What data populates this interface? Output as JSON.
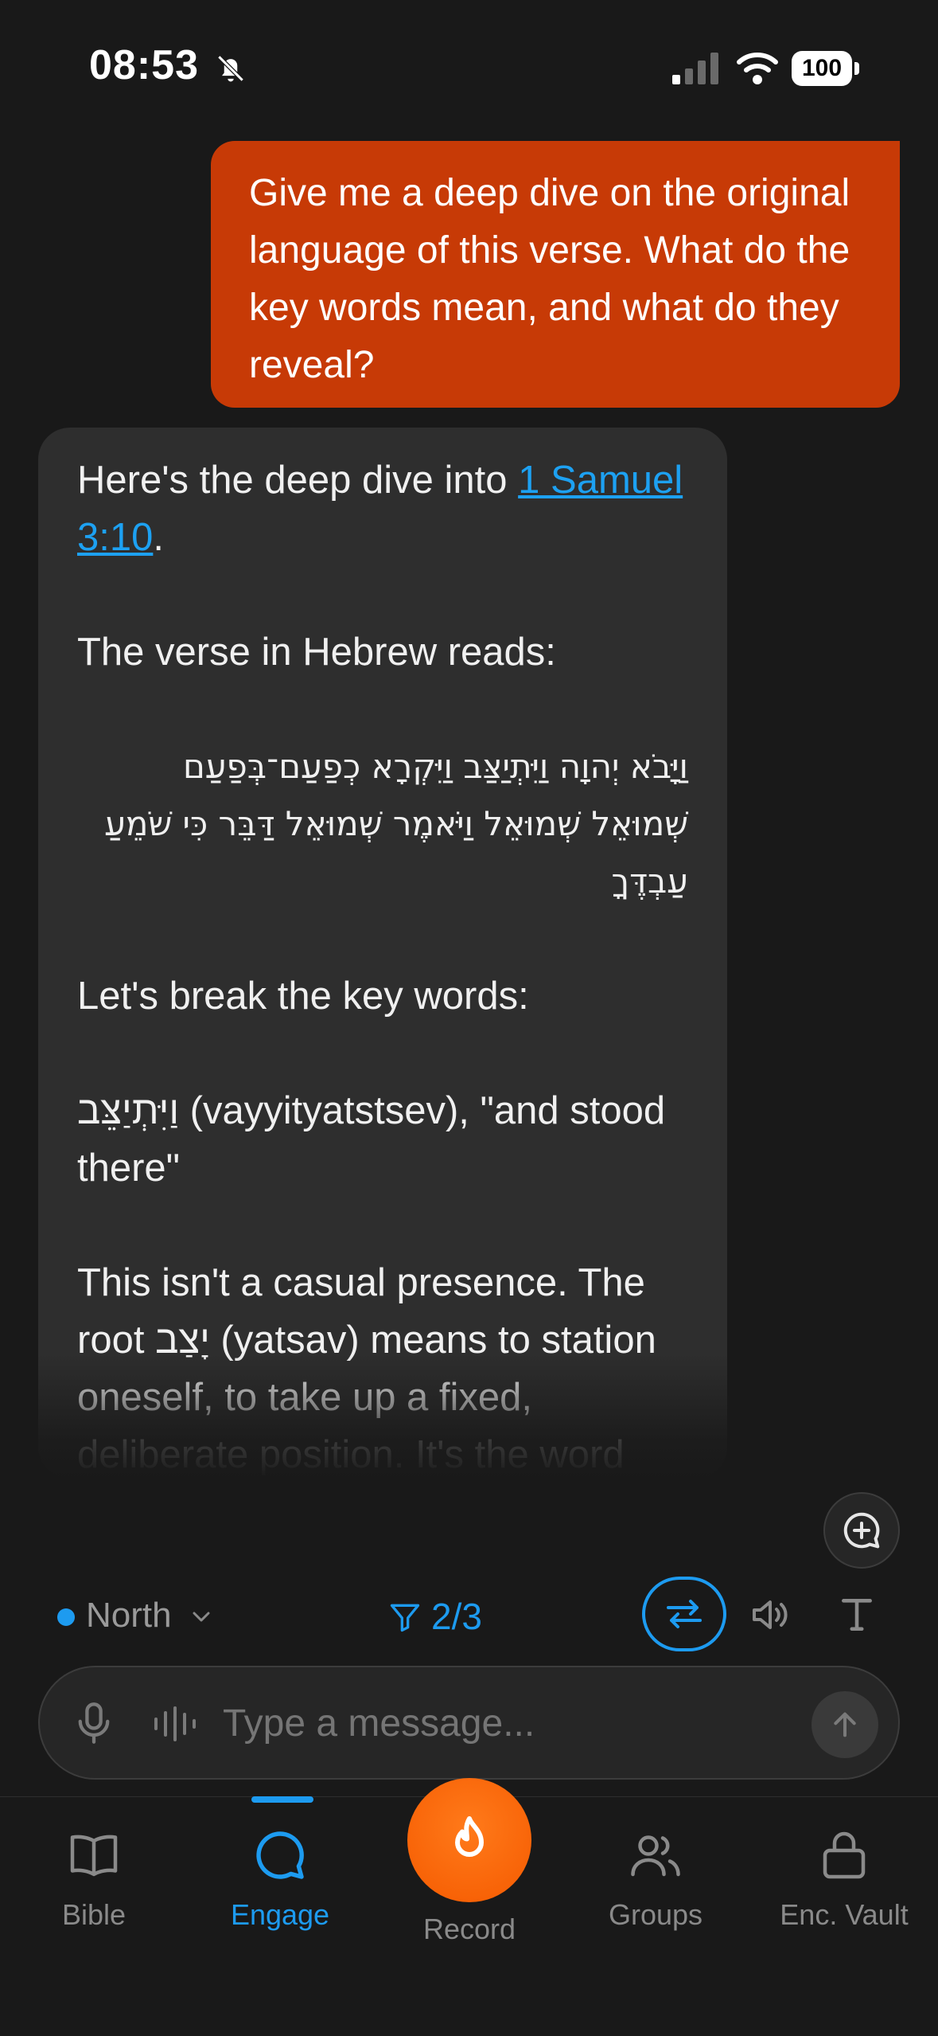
{
  "status_bar": {
    "time": "08:53",
    "battery": "100"
  },
  "conversation": {
    "user_message": "Give me a deep dive on the original language of this verse. What do the key words mean, and what do they reveal?",
    "assistant": {
      "intro_prefix": "Here's the deep dive into ",
      "intro_link": "1 Samuel 3:10",
      "intro_suffix": ".",
      "hebrew_intro": "The verse in Hebrew reads:",
      "hebrew_text": "וַיָּבֹא יְהוָה וַיִּתְיַצַּב וַיִּקְרָא כְפַעַם־בְּפַעַם שְׁמוּאֵל שְׁמוּאֵל וַיֹּאמֶר שְׁמוּאֵל דַּבֵּר כִּי שֹׁמֵעַ עַבְדֶּךָ",
      "breakdown_intro": "Let's break the key words:",
      "word_entry": "וַיִּתְיַצֵּב (vayyityatstsev), \"and stood there\"",
      "paragraph": "This isn't a casual presence. The root יָצַב (yatsav) means to station oneself, to take up a fixed, deliberate position. It's the word"
    }
  },
  "controls": {
    "direction_label": "North",
    "filter_label": "2/3",
    "accent_color": "#1d9bf0"
  },
  "input": {
    "placeholder": "Type a message..."
  },
  "tabs": [
    {
      "label": "Bible",
      "icon": "book-icon"
    },
    {
      "label": "Engage",
      "icon": "chat-bubble-icon",
      "active": true
    },
    {
      "label": "Record",
      "icon": "flame-icon"
    },
    {
      "label": "Groups",
      "icon": "users-icon"
    },
    {
      "label": "Enc. Vault",
      "icon": "lock-icon"
    }
  ]
}
